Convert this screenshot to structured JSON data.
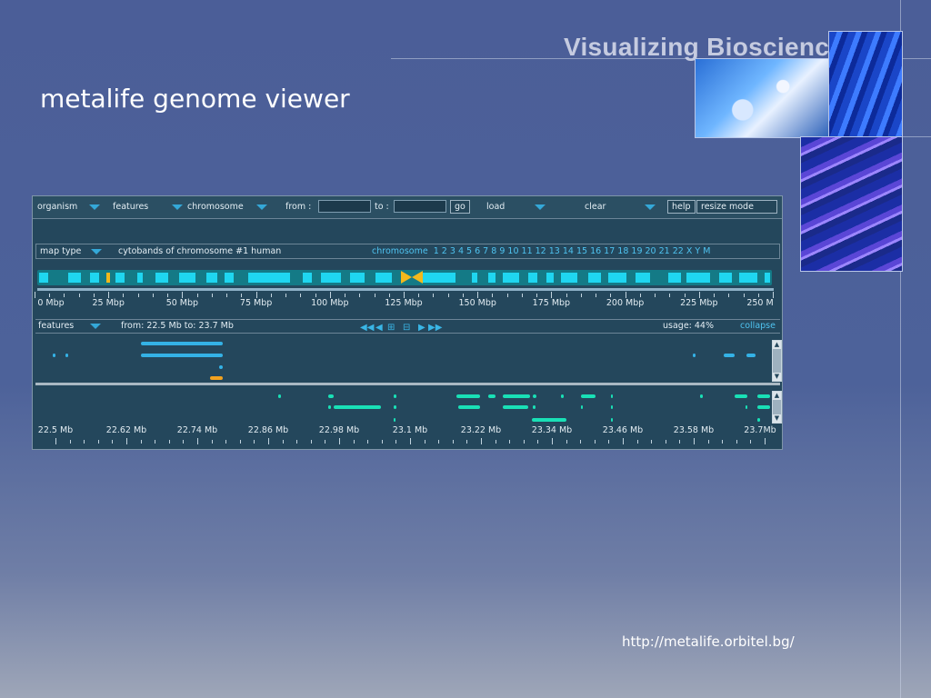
{
  "slide": {
    "title": "metalife genome viewer",
    "brand": "Visualizing Biosciences",
    "url": "http://metalife.orbitel.bg/"
  },
  "viewer": {
    "toolbar": {
      "organism": "organism",
      "features": "features",
      "chromosome": "chromosome",
      "from_label": "from :",
      "to_label": "to :",
      "go": "go",
      "load": "load",
      "clear": "clear",
      "help": "help",
      "resize": "resize mode"
    },
    "map": {
      "map_type": "map type",
      "description": "cytobands of chromosome #1 human",
      "chromosome_label": "chromosome",
      "chromosomes": [
        "1",
        "2",
        "3",
        "4",
        "5",
        "6",
        "7",
        "8",
        "9",
        "10",
        "11",
        "12",
        "13",
        "14",
        "15",
        "16",
        "17",
        "18",
        "19",
        "20",
        "21",
        "22",
        "X",
        "Y",
        "M"
      ]
    },
    "genome_scale": [
      "0 Mbp",
      "25 Mbp",
      "50 Mbp",
      "75 Mbp",
      "100 Mbp",
      "125 Mbp",
      "150 Mbp",
      "175 Mbp",
      "200 Mbp",
      "225 Mbp",
      "250 M"
    ],
    "features_bar": {
      "features": "features",
      "range": "from: 22.5 Mb to: 23.7 Mb",
      "usage": "usage: 44%",
      "collapse": "collapse"
    },
    "region_scale": [
      "22.5 Mb",
      "22.62 Mb",
      "22.74 Mb",
      "22.86 Mb",
      "22.98 Mb",
      "23.1 Mb",
      "23.22 Mb",
      "23.34 Mb",
      "23.46 Mb",
      "23.58 Mb",
      "23.7Mb"
    ],
    "colors": {
      "bg": "#24475c",
      "band": "#1fd6f0",
      "centromere": "#f2b81c",
      "accent": "#4fc3f0",
      "feature_blue": "#34b2e6",
      "feature_cyan": "#19e0b6",
      "feature_orange": "#f2a21f"
    }
  }
}
